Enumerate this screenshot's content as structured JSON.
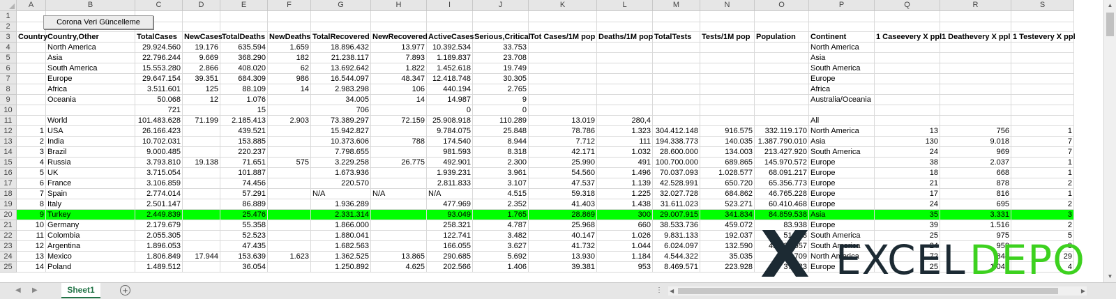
{
  "button": {
    "label": "Corona Veri Güncelleme"
  },
  "sheet_tab": {
    "label": "Sheet1"
  },
  "add_sheet_icon": "plus-circle-icon",
  "columns": [
    "A",
    "B",
    "C",
    "D",
    "E",
    "F",
    "G",
    "H",
    "I",
    "J",
    "K",
    "L",
    "M",
    "N",
    "O",
    "P",
    "Q",
    "R",
    "S"
  ],
  "row_numbers": [
    "1",
    "2",
    "3",
    "4",
    "5",
    "6",
    "7",
    "8",
    "9",
    "10",
    "11",
    "12",
    "13",
    "14",
    "15",
    "16",
    "17",
    "18",
    "19",
    "20",
    "21",
    "22",
    "23",
    "24",
    "25"
  ],
  "headers": [
    "Country",
    "Country,Other",
    "TotalCases",
    "NewCases",
    "TotalDeaths",
    "NewDeaths",
    "TotalRecovered",
    "NewRecovered",
    "ActiveCases",
    "Serious,Critical",
    "Tot Cases/1M pop",
    "Deaths/1M pop",
    "TotalTests",
    "Tests/1M pop",
    "Population",
    "Continent",
    "1 Caseevery X ppl",
    "1 Deathevery X ppl",
    "1 Testevery X ppl"
  ],
  "rows": [
    [
      "",
      "North America",
      "29.924.560",
      "19.176",
      "635.594",
      "1.659",
      "18.896.432",
      "13.977",
      "10.392.534",
      "33.753",
      "",
      "",
      "",
      "",
      "",
      "North America",
      "",
      "",
      ""
    ],
    [
      "",
      "Asia",
      "22.796.244",
      "9.669",
      "368.290",
      "182",
      "21.238.117",
      "7.893",
      "1.189.837",
      "23.708",
      "",
      "",
      "",
      "",
      "",
      "Asia",
      "",
      "",
      ""
    ],
    [
      "",
      "South America",
      "15.553.280",
      "2.866",
      "408.020",
      "62",
      "13.692.642",
      "1.822",
      "1.452.618",
      "19.749",
      "",
      "",
      "",
      "",
      "",
      "South America",
      "",
      "",
      ""
    ],
    [
      "",
      "Europe",
      "29.647.154",
      "39.351",
      "684.309",
      "986",
      "16.544.097",
      "48.347",
      "12.418.748",
      "30.305",
      "",
      "",
      "",
      "",
      "",
      "Europe",
      "",
      "",
      ""
    ],
    [
      "",
      "Africa",
      "3.511.601",
      "125",
      "88.109",
      "14",
      "2.983.298",
      "106",
      "440.194",
      "2.765",
      "",
      "",
      "",
      "",
      "",
      "Africa",
      "",
      "",
      ""
    ],
    [
      "",
      "Oceania",
      "50.068",
      "12",
      "1.076",
      "",
      "34.005",
      "14",
      "14.987",
      "9",
      "",
      "",
      "",
      "",
      "",
      "Australia/Oceania",
      "",
      "",
      ""
    ],
    [
      "",
      "",
      "721",
      "",
      "15",
      "",
      "706",
      "",
      "0",
      "0",
      "",
      "",
      "",
      "",
      "",
      "",
      "",
      "",
      ""
    ],
    [
      "",
      "World",
      "101.483.628",
      "71.199",
      "2.185.413",
      "2.903",
      "73.389.297",
      "72.159",
      "25.908.918",
      "110.289",
      "13.019",
      "280,4",
      "",
      "",
      "",
      "All",
      "",
      "",
      ""
    ],
    [
      "1",
      "USA",
      "26.166.423",
      "",
      "439.521",
      "",
      "15.942.827",
      "",
      "9.784.075",
      "25.848",
      "78.786",
      "1.323",
      "304.412.148",
      "916.575",
      "332.119.170",
      "North America",
      "13",
      "756",
      "1"
    ],
    [
      "2",
      "India",
      "10.702.031",
      "",
      "153.885",
      "",
      "10.373.606",
      "788",
      "174.540",
      "8.944",
      "7.712",
      "111",
      "194.338.773",
      "140.035",
      "1.387.790.010",
      "Asia",
      "130",
      "9.018",
      "7"
    ],
    [
      "3",
      "Brazil",
      "9.000.485",
      "",
      "220.237",
      "",
      "7.798.655",
      "",
      "981.593",
      "8.318",
      "42.171",
      "1.032",
      "28.600.000",
      "134.003",
      "213.427.920",
      "South America",
      "24",
      "969",
      "7"
    ],
    [
      "4",
      "Russia",
      "3.793.810",
      "19.138",
      "71.651",
      "575",
      "3.229.258",
      "26.775",
      "492.901",
      "2.300",
      "25.990",
      "491",
      "100.700.000",
      "689.865",
      "145.970.572",
      "Europe",
      "38",
      "2.037",
      "1"
    ],
    [
      "5",
      "UK",
      "3.715.054",
      "",
      "101.887",
      "",
      "1.673.936",
      "",
      "1.939.231",
      "3.961",
      "54.560",
      "1.496",
      "70.037.093",
      "1.028.577",
      "68.091.217",
      "Europe",
      "18",
      "668",
      "1"
    ],
    [
      "6",
      "France",
      "3.106.859",
      "",
      "74.456",
      "",
      "220.570",
      "",
      "2.811.833",
      "3.107",
      "47.537",
      "1.139",
      "42.528.991",
      "650.720",
      "65.356.773",
      "Europe",
      "21",
      "878",
      "2"
    ],
    [
      "7",
      "Spain",
      "2.774.014",
      "",
      "57.291",
      "",
      "N/A",
      "N/A",
      "N/A",
      "4.515",
      "59.318",
      "1.225",
      "32.027.728",
      "684.862",
      "46.765.228",
      "Europe",
      "17",
      "816",
      "1"
    ],
    [
      "8",
      "Italy",
      "2.501.147",
      "",
      "86.889",
      "",
      "1.936.289",
      "",
      "477.969",
      "2.352",
      "41.403",
      "1.438",
      "31.611.023",
      "523.271",
      "60.410.468",
      "Europe",
      "24",
      "695",
      "2"
    ],
    [
      "9",
      "Turkey",
      "2.449.839",
      "",
      "25.476",
      "",
      "2.331.314",
      "",
      "93.049",
      "1.765",
      "28.869",
      "300",
      "29.007.915",
      "341.834",
      "84.859.538",
      "Asia",
      "35",
      "3.331",
      "3"
    ],
    [
      "10",
      "Germany",
      "2.179.679",
      "",
      "55.358",
      "",
      "1.866.000",
      "",
      "258.321",
      "4.787",
      "25.968",
      "660",
      "38.533.736",
      "459.072",
      "83.938",
      "Europe",
      "39",
      "1.516",
      "2"
    ],
    [
      "11",
      "Colombia",
      "2.055.305",
      "",
      "52.523",
      "",
      "1.880.041",
      "",
      "122.741",
      "3.482",
      "40.147",
      "1.026",
      "9.831.133",
      "192.037",
      "51.193",
      "South America",
      "25",
      "975",
      "5"
    ],
    [
      "12",
      "Argentina",
      "1.896.053",
      "",
      "47.435",
      "",
      "1.682.563",
      "",
      "166.055",
      "3.627",
      "41.732",
      "1.044",
      "6.024.097",
      "132.590",
      "45.433.657",
      "South America",
      "24",
      "958",
      "8"
    ],
    [
      "13",
      "Mexico",
      "1.806.849",
      "17.944",
      "153.639",
      "1.623",
      "1.362.525",
      "13.865",
      "290.685",
      "5.692",
      "13.930",
      "1.184",
      "4.544.322",
      "35.035",
      "129.709",
      "North America",
      "72",
      "844",
      "29"
    ],
    [
      "14",
      "Poland",
      "1.489.512",
      "",
      "36.054",
      "",
      "1.250.892",
      "4.625",
      "202.566",
      "1.406",
      "39.381",
      "953",
      "8.469.571",
      "223.928",
      "37.823",
      "Europe",
      "25",
      "1.049",
      "4"
    ]
  ],
  "highlight_row_index": 16,
  "highlight_color": "#00ff00",
  "watermark": {
    "x": "X",
    "excel": "EXCEL",
    "depo": "DEPO",
    "brand_green": "#3dd11f",
    "brand_dark": "#1c2a33"
  }
}
